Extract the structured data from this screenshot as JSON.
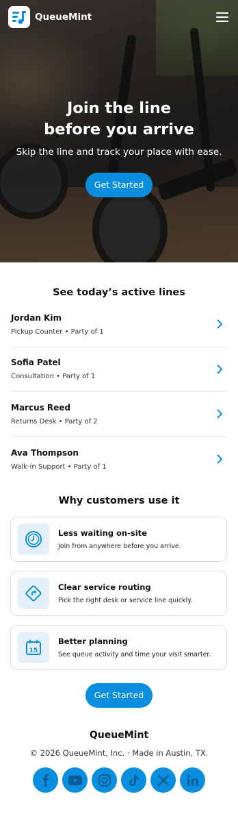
{
  "app": {
    "name": "QueueMint"
  },
  "nav": {
    "menu_icon": "hamburger-menu-icon"
  },
  "hero": {
    "title_line1": "Join the line",
    "title_line2": "before you arrive",
    "subtitle": "Skip the line and track your place with ease.",
    "cta_label": "Get Started"
  },
  "active_lines": {
    "heading": "See today’s active lines",
    "items": [
      {
        "name": "Jordan Kim",
        "meta": "Pickup Counter • Party of 1"
      },
      {
        "name": "Sofia Patel",
        "meta": "Consultation • Party of 1"
      },
      {
        "name": "Marcus Reed",
        "meta": "Returns Desk • Party of 2"
      },
      {
        "name": "Ava Thompson",
        "meta": "Walk-in Support • Party of 1"
      }
    ]
  },
  "why": {
    "heading": "Why customers use it",
    "cards": [
      {
        "icon": "clock-icon",
        "title": "Less waiting on-site",
        "desc": "Join from anywhere before you arrive."
      },
      {
        "icon": "routing-sign-icon",
        "title": "Clear service routing",
        "desc": "Pick the right desk or service line quickly."
      },
      {
        "icon": "calendar-icon",
        "title": "Better planning",
        "desc": "See queue activity and time your visit smarter.",
        "calendar_day": "15"
      }
    ]
  },
  "cta2": {
    "label": "Get Started"
  },
  "footer": {
    "brand": "QueueMint",
    "copyright": "© 2026 QueueMint, Inc. · Made in Austin, TX.",
    "socials": [
      "facebook-icon",
      "youtube-icon",
      "instagram-icon",
      "tiktok-icon",
      "x-icon",
      "linkedin-icon"
    ]
  },
  "colors": {
    "accent": "#0a8fe0",
    "icon_bg": "#e4f1fb",
    "text": "#111111"
  }
}
